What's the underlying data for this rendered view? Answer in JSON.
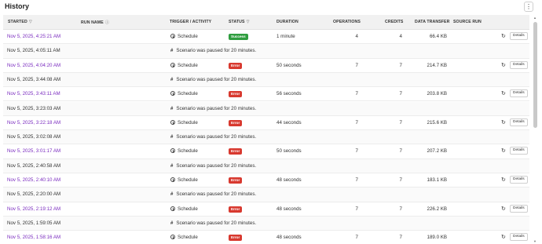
{
  "header": {
    "title": "History",
    "menu_icon": "kebab-icon"
  },
  "columns": {
    "started": "STARTED",
    "run_name": "RUN NAME",
    "trigger": "TRIGGER / ACTIVITY",
    "status": "STATUS",
    "duration": "DURATION",
    "operations": "OPERATIONS",
    "credits": "CREDITS",
    "data_transfer": "DATA TRANSFER",
    "source_run": "SOURCE RUN"
  },
  "rows": [
    {
      "started": "Nov 5, 2025, 4:25:21 AM",
      "trigger": "Schedule",
      "status": "Success",
      "duration": "1 minute",
      "operations": "4",
      "credits": "4",
      "data_transfer": "66.4 KB",
      "details": "Details"
    },
    {
      "started": "Nov 5, 2025, 4:05:11 AM",
      "note": "Scenario was paused for 20 minutes."
    },
    {
      "started": "Nov 5, 2025, 4:04:20 AM",
      "trigger": "Schedule",
      "status": "Error",
      "duration": "50 seconds",
      "operations": "7",
      "credits": "7",
      "data_transfer": "214.7 KB",
      "details": "Details"
    },
    {
      "started": "Nov 5, 2025, 3:44:08 AM",
      "note": "Scenario was paused for 20 minutes."
    },
    {
      "started": "Nov 5, 2025, 3:43:11 AM",
      "trigger": "Schedule",
      "status": "Error",
      "duration": "56 seconds",
      "operations": "7",
      "credits": "7",
      "data_transfer": "203.8 KB",
      "details": "Details"
    },
    {
      "started": "Nov 5, 2025, 3:23:03 AM",
      "note": "Scenario was paused for 20 minutes."
    },
    {
      "started": "Nov 5, 2025, 3:22:18 AM",
      "trigger": "Schedule",
      "status": "Error",
      "duration": "44 seconds",
      "operations": "7",
      "credits": "7",
      "data_transfer": "215.6 KB",
      "details": "Details"
    },
    {
      "started": "Nov 5, 2025, 3:02:08 AM",
      "note": "Scenario was paused for 20 minutes."
    },
    {
      "started": "Nov 5, 2025, 3:01:17 AM",
      "trigger": "Schedule",
      "status": "Error",
      "duration": "50 seconds",
      "operations": "7",
      "credits": "7",
      "data_transfer": "207.2 KB",
      "details": "Details"
    },
    {
      "started": "Nov 5, 2025, 2:40:58 AM",
      "note": "Scenario was paused for 20 minutes."
    },
    {
      "started": "Nov 5, 2025, 2:40:10 AM",
      "trigger": "Schedule",
      "status": "Error",
      "duration": "48 seconds",
      "operations": "7",
      "credits": "7",
      "data_transfer": "183.1 KB",
      "details": "Details"
    },
    {
      "started": "Nov 5, 2025, 2:20:00 AM",
      "note": "Scenario was paused for 20 minutes."
    },
    {
      "started": "Nov 5, 2025, 2:19:12 AM",
      "trigger": "Schedule",
      "status": "Error",
      "duration": "48 seconds",
      "operations": "7",
      "credits": "7",
      "data_transfer": "226.2 KB",
      "details": "Details"
    },
    {
      "started": "Nov 5, 2025, 1:59:05 AM",
      "note": "Scenario was paused for 20 minutes."
    },
    {
      "started": "Nov 5, 2025, 1:58:16 AM",
      "trigger": "Schedule",
      "status": "Error",
      "duration": "48 seconds",
      "operations": "7",
      "credits": "7",
      "data_transfer": "189.0 KB",
      "details": "Details"
    }
  ],
  "colors": {
    "link": "#7a2bbf",
    "success": "#2f9d3f",
    "error": "#d8392f"
  }
}
